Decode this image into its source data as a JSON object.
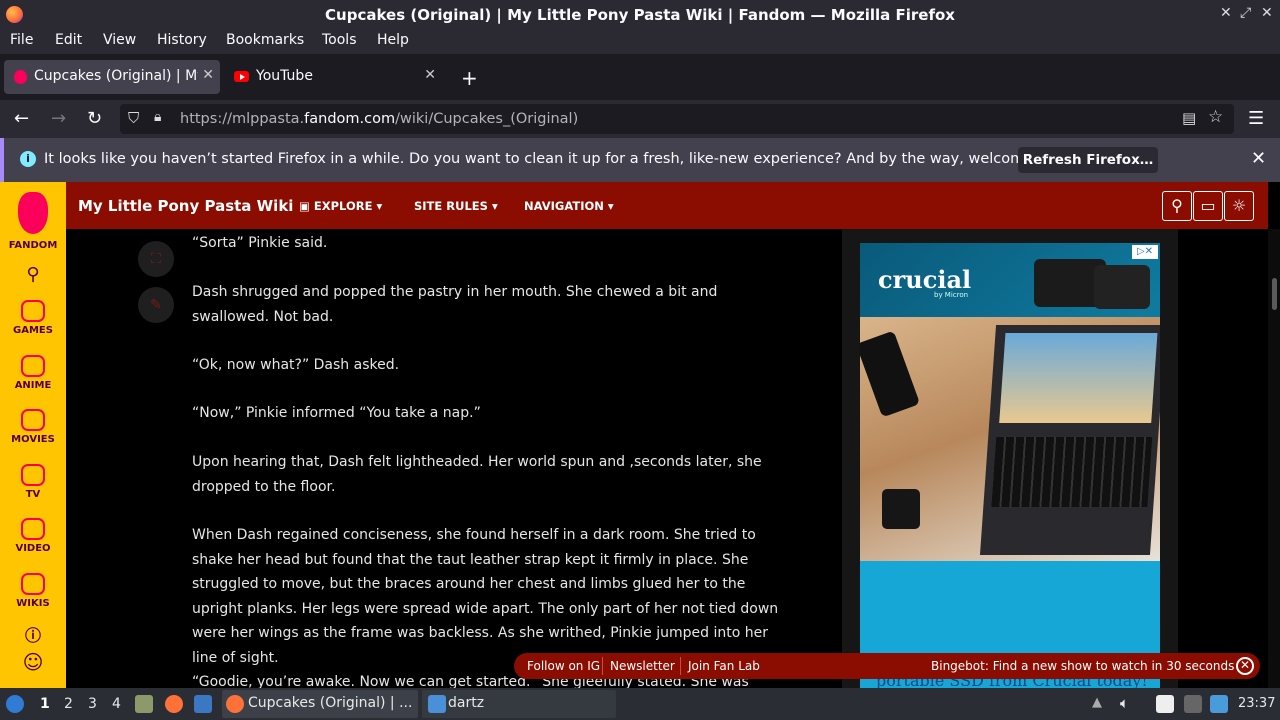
{
  "window": {
    "title": "Cupcakes (Original) | My Little Pony Pasta Wiki | Fandom — Mozilla Firefox"
  },
  "menu": [
    "File",
    "Edit",
    "View",
    "History",
    "Bookmarks",
    "Tools",
    "Help"
  ],
  "tabs": [
    {
      "label": "Cupcakes (Original) | My"
    },
    {
      "label": "YouTube"
    }
  ],
  "navbar": {
    "url_prefix": "https://mlppasta.",
    "url_domain": "fandom.com",
    "url_path": "/wiki/Cupcakes_(Original)"
  },
  "notification": {
    "message": "It looks like you haven’t started Firefox in a while. Do you want to clean it up for a fresh, like-new experience? And by the way, welcome back!",
    "button": "Refresh Firefox…"
  },
  "fandom_sidebar": {
    "brand": "FANDOM",
    "items": [
      "GAMES",
      "ANIME",
      "MOVIES",
      "TV",
      "VIDEO",
      "WIKIS"
    ]
  },
  "wiki_header": {
    "name": "My Little Pony Pasta Wiki",
    "nav": [
      "EXPLORE",
      "SITE RULES",
      "NAVIGATION"
    ]
  },
  "article": {
    "paragraphs": [
      "“Sorta” Pinkie said.",
      "Dash shrugged and popped the pastry in her mouth. She chewed a bit and swallowed. Not bad.",
      "“Ok, now what?” Dash asked.",
      "“Now,” Pinkie informed “You take a nap.”",
      "Upon hearing that, Dash felt lightheaded. Her world spun and ,seconds later, she dropped to the floor.",
      "When Dash regained conciseness, she found herself in a dark room. She tried to shake her head but found that the taut leather strap kept it firmly in place. She struggled to move, but the braces around her chest and limbs glued her to the upright planks. Her legs were spread wide apart. The only part of her not tied down were her wings as the frame was backless. As she writhed, Pinkie jumped into her line of sight.",
      "“Goodie, you’re awake. Now we can get started.” She gleefully stated. She was pushing a cart"
    ]
  },
  "ad": {
    "brand": "crucial",
    "sub": "by Micron",
    "tagline": "portable SSD from Crucial today!"
  },
  "bingebot": {
    "links": [
      "Follow on IG",
      "Newsletter",
      "Join Fan Lab"
    ],
    "message": "Bingebot: Find a new show to watch in 30 seconds"
  },
  "taskbar": {
    "workspaces": [
      "1",
      "2",
      "3",
      "4"
    ],
    "windows": [
      "Cupcakes (Original) | ...",
      "dartz"
    ],
    "clock": "23:37"
  }
}
